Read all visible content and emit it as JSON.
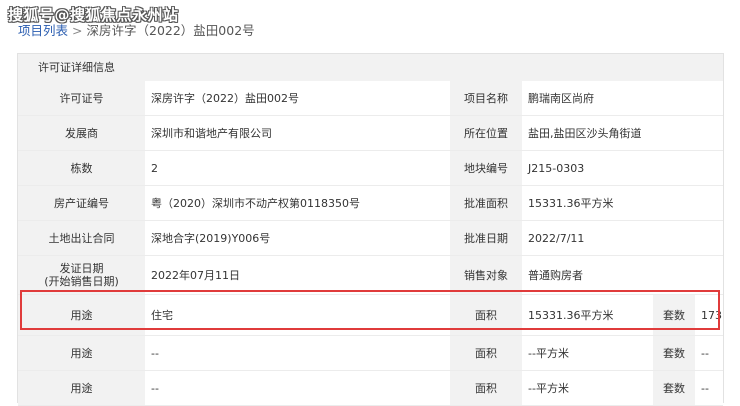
{
  "watermark": "搜狐号@搜狐焦点永州站",
  "breadcrumb": {
    "link": "项目列表",
    "separator": ">",
    "current": "深房许字（2022）盐田002号"
  },
  "panel": {
    "title": "许可证详细信息"
  },
  "rows": [
    {
      "label1": "许可证号",
      "value1": "深房许字（2022）盐田002号",
      "label2": "项目名称",
      "value2": "鹏瑞南区尚府"
    },
    {
      "label1": "发展商",
      "value1": "深圳市和谐地产有限公司",
      "label2": "所在位置",
      "value2": "盐田,盐田区沙头角街道"
    },
    {
      "label1": "栋数",
      "value1": "2",
      "label2": "地块编号",
      "value2": "J215-0303"
    },
    {
      "label1": "房产证编号",
      "value1": "粤（2020）深圳市不动产权第0118350号",
      "label2": "批准面积",
      "value2": "15331.36平方米"
    },
    {
      "label1": "土地出让合同",
      "value1": "深地合字(2019)Y006号",
      "label2": "批准日期",
      "value2": "2022/7/11"
    },
    {
      "label1_line1": "发证日期",
      "label1_line2": "(开始销售日期)",
      "value1": "2022年07月11日",
      "label2": "销售对象",
      "value2": "普通购房者"
    }
  ],
  "usage_rows": [
    {
      "label1": "用途",
      "value1": "住宅",
      "label2": "面积",
      "value2": "15331.36平方米",
      "label3": "套数",
      "value3": "173"
    },
    {
      "label1": "用途",
      "value1": "--",
      "label2": "面积",
      "value2": "--平方米",
      "label3": "套数",
      "value3": "--"
    },
    {
      "label1": "用途",
      "value1": "--",
      "label2": "面积",
      "value2": "--平方米",
      "label3": "套数",
      "value3": "--"
    }
  ],
  "colors": {
    "highlight_border": "#e03b3b",
    "link": "#2a5db0",
    "label_bg": "#f2f2f2"
  }
}
